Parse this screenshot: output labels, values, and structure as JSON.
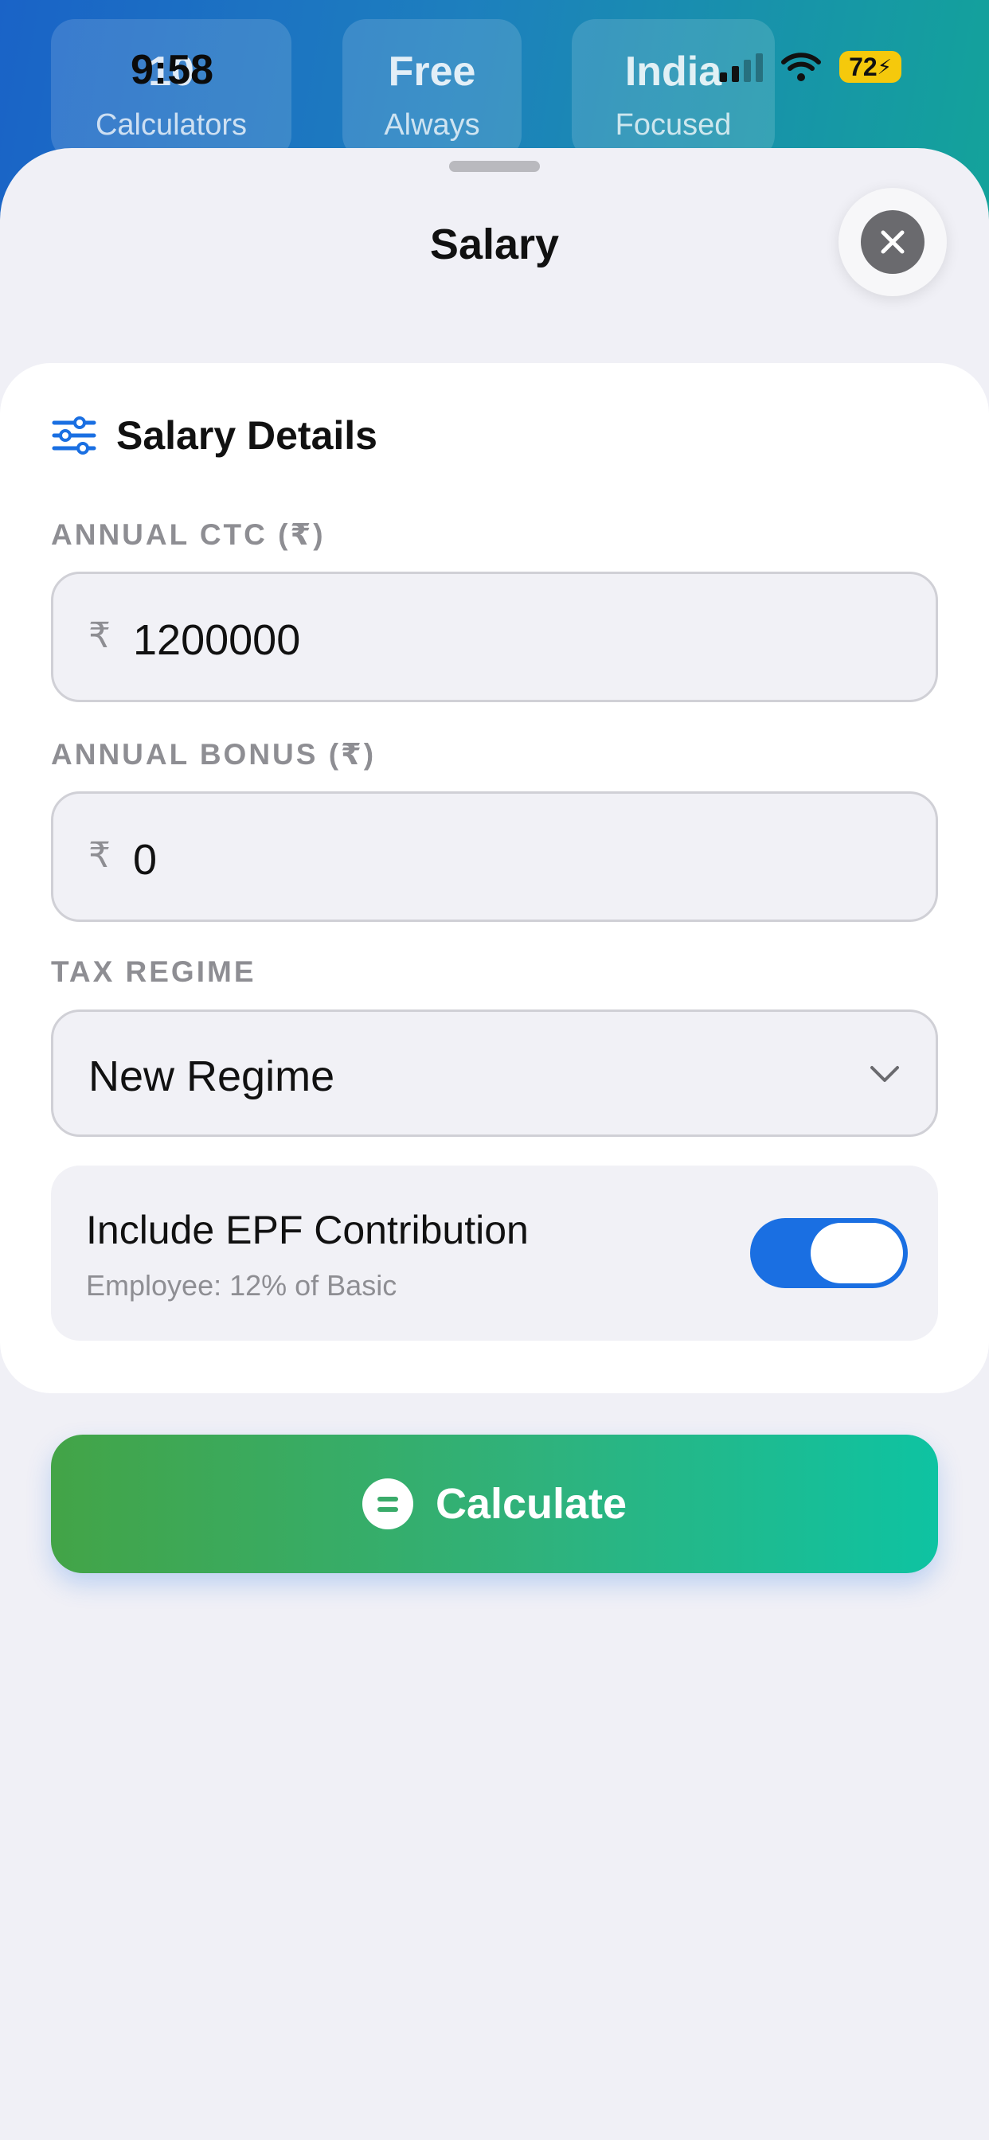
{
  "status_bar": {
    "time": "9:58",
    "battery": "72"
  },
  "background": {
    "stats": [
      {
        "value": "10",
        "label": "Calculators"
      },
      {
        "value": "Free",
        "label": "Always"
      },
      {
        "value": "India",
        "label": "Focused"
      }
    ]
  },
  "sheet": {
    "title": "Salary",
    "section_title": "Salary Details",
    "annual_ctc": {
      "label": "ANNUAL CTC (₹)",
      "currency": "₹",
      "value": "1200000"
    },
    "annual_bonus": {
      "label": "ANNUAL BONUS (₹)",
      "currency": "₹",
      "value": "0"
    },
    "tax_regime": {
      "label": "TAX REGIME",
      "selected": "New Regime"
    },
    "epf": {
      "title": "Include EPF Contribution",
      "subtitle": "Employee: 12% of Basic",
      "enabled": true
    },
    "calculate_label": "Calculate"
  },
  "colors": {
    "accent": "#1a6fe2",
    "button_gradient_start": "#43a447",
    "button_gradient_end": "#0ec3a2"
  }
}
